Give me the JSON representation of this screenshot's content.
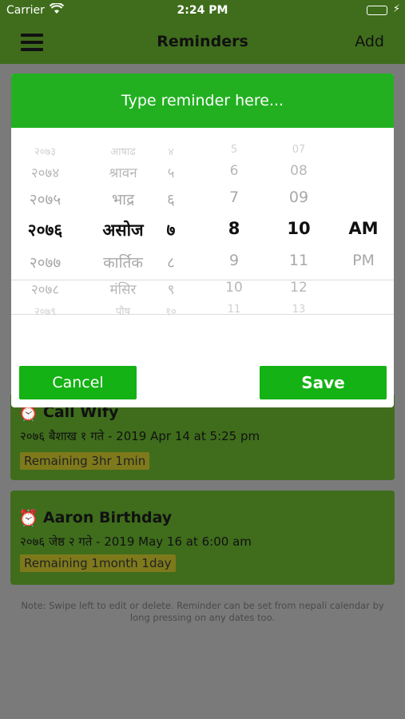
{
  "status_bar": {
    "carrier": "Carrier",
    "time": "2:24 PM"
  },
  "nav": {
    "title": "Reminders",
    "add_label": "Add"
  },
  "reminders": [
    {
      "title": "Call Wify",
      "date": "२०७६ बैशाख १ गते - 2019 Apr 14 at 5:25 pm",
      "remaining": "Remaining 3hr 1min"
    },
    {
      "title": "Aaron Birthday",
      "date": "२०७६ जेष्ठ २ गते - 2019 May 16 at 6:00 am",
      "remaining": "Remaining 1month 1day"
    }
  ],
  "note": "Note: Swipe left to edit or delete. Reminder can be set from nepali calendar by long pressing on any dates too.",
  "modal": {
    "placeholder": "Type reminder here...",
    "cancel_label": "Cancel",
    "save_label": "Save",
    "picker": {
      "year": [
        "२०७३",
        "२०७४",
        "२०७५",
        "२०७६",
        "२०७७",
        "२०७८",
        "२०७९"
      ],
      "month": [
        "आषाढ",
        "श्रावन",
        "भाद्र",
        "असोज",
        "कार्तिक",
        "मंसिर",
        "पौष"
      ],
      "day": [
        "४",
        "५",
        "६",
        "७",
        "८",
        "९",
        "१०"
      ],
      "hour": [
        "5",
        "6",
        "7",
        "8",
        "9",
        "10",
        "11"
      ],
      "minute": [
        "07",
        "08",
        "09",
        "10",
        "11",
        "12",
        "13"
      ],
      "ampm": [
        "",
        "",
        "",
        "AM",
        "PM",
        "",
        ""
      ]
    }
  },
  "colors": {
    "header_green": "#22b021",
    "button_green": "#14b214",
    "dim_overlay": "#7a7a7a"
  }
}
